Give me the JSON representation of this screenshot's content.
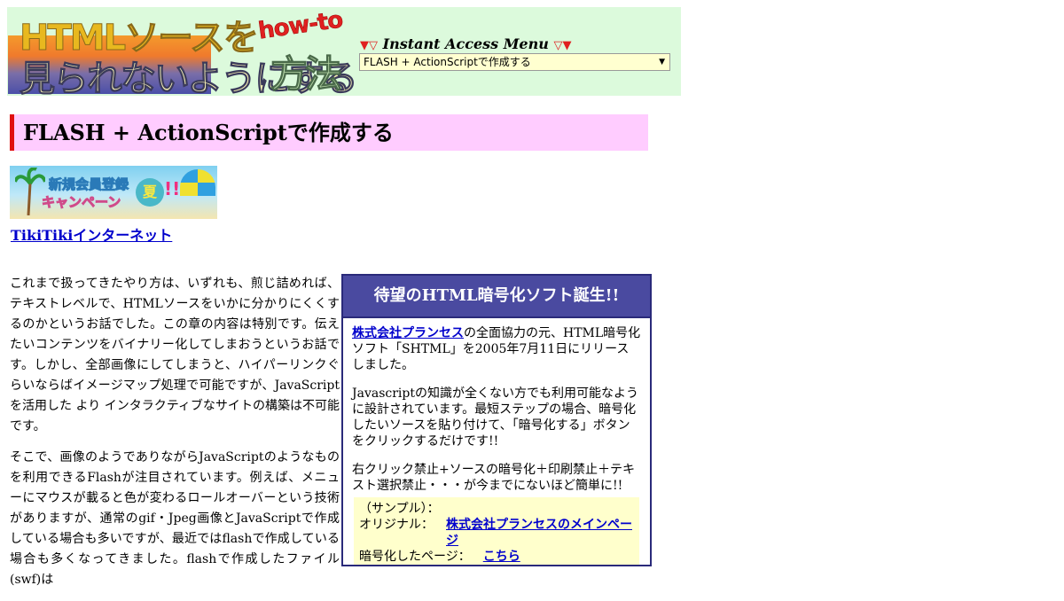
{
  "header": {
    "logo_line1": "HTMLソースを",
    "logo_line2": "見られないようにする",
    "logo_howto": "how-to",
    "logo_houhou": "方法",
    "menu_title": "Instant Access Menu",
    "menu_tri_left": "▼▽",
    "menu_tri_right": "▽▼",
    "menu_selected": "FLASH + ActionScriptで作成する",
    "menu_arrow": "▼"
  },
  "page_title": "FLASH + ActionScriptで作成する",
  "banner": {
    "line1": "新規会員登録",
    "line2": "キャンペーン",
    "sun_text": "夏",
    "exclaim": "!!"
  },
  "tiki_link": "TikiTikiインターネット",
  "body_paragraphs": [
    "これまで扱ってきたやり方は、いずれも、煎じ詰めれば、テキストレベルで、HTMLソースをいかに分かりにくくするのかというお話でした。この章の内容は特別です。伝えたいコンテンツをバイナリー化してしまおうというお話です。しかし、全部画像にしてしまうと、ハイパーリンクぐらいならばイメージマップ処理で可能ですが、JavaScriptを活用した より インタラクティブなサイトの構築は不可能です。",
    "そこで、画像のようでありながらJavaScriptのようなものを利用できるFlashが注目されています。例えば、メニューにマウスが載ると色が変わるロールオーバーという技術がありますが、通常のgif・Jpeg画像とJavaScriptで作成している場合も多いですが、最近ではflashで作成している場合も多くなってきました。flashで作成したファイル(swf)は"
  ],
  "promo": {
    "heading": "待望のHTML暗号化ソフト誕生!!",
    "p1_link": "株式会社プランセス",
    "p1_text": "の全面協力の元、HTML暗号化ソフト「SHTML」を2005年7月11日にリリースしました。",
    "p2": "Javascriptの知識が全くない方でも利用可能なように設計されています。最短ステップの場合、暗号化したいソースを貼り付けて、「暗号化する」ボタンをクリックするだけです!!",
    "p3": "右クリック禁止+ソースの暗号化＋印刷禁止＋テキスト選択禁止・・・が今までにないほど簡単に!!",
    "sample_label": "（サンプル）：",
    "original_label": "オリジナル：",
    "original_link": "株式会社プランセスのメインページ",
    "encrypted_label": "暗号化したページ：",
    "encrypted_link": "こちら"
  }
}
